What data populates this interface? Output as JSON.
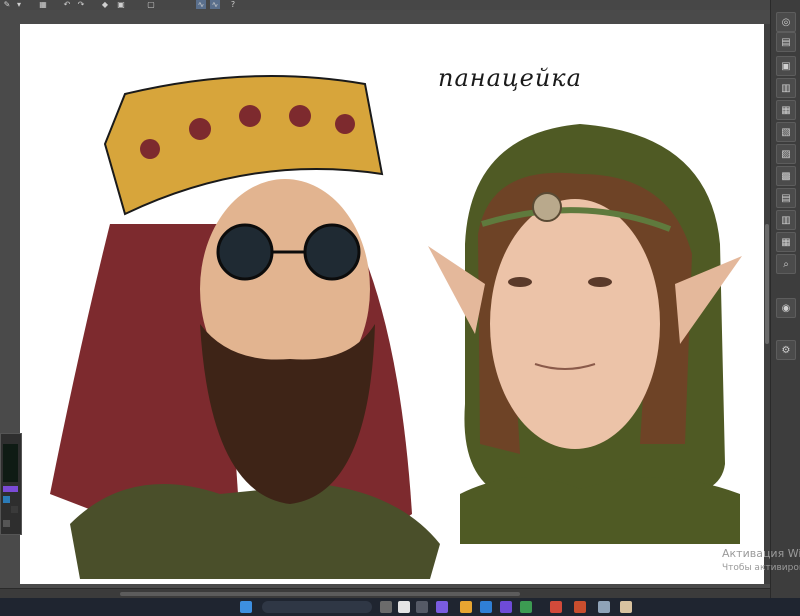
{
  "canvas": {
    "handwritten_text": "панацейка"
  },
  "watermark": {
    "title": "Активация Wi",
    "subtitle": "Чтобы активирова"
  },
  "toolbar": {
    "icons": [
      "brush-icon",
      "dropdown-icon",
      "grid-icon",
      "undo-icon",
      "redo-icon",
      "fill-icon",
      "transform-icon",
      "select-icon",
      "lasso-icon",
      "pen-icon",
      "help-icon"
    ]
  },
  "right_panel": {
    "icons": [
      "zoom-icon",
      "layer-icon",
      "navigator-icon",
      "property-icon",
      "brush-size-icon",
      "color-icon",
      "history-icon",
      "material-icon",
      "sub-tool-icon",
      "tool-property-icon",
      "layer-property-icon",
      "search-icon",
      "camera-icon",
      "settings-icon"
    ]
  },
  "colors": {
    "canvas_bg": "#ffffff",
    "app_bg": "#4a4a4a",
    "taskbar": "#1f2530"
  }
}
